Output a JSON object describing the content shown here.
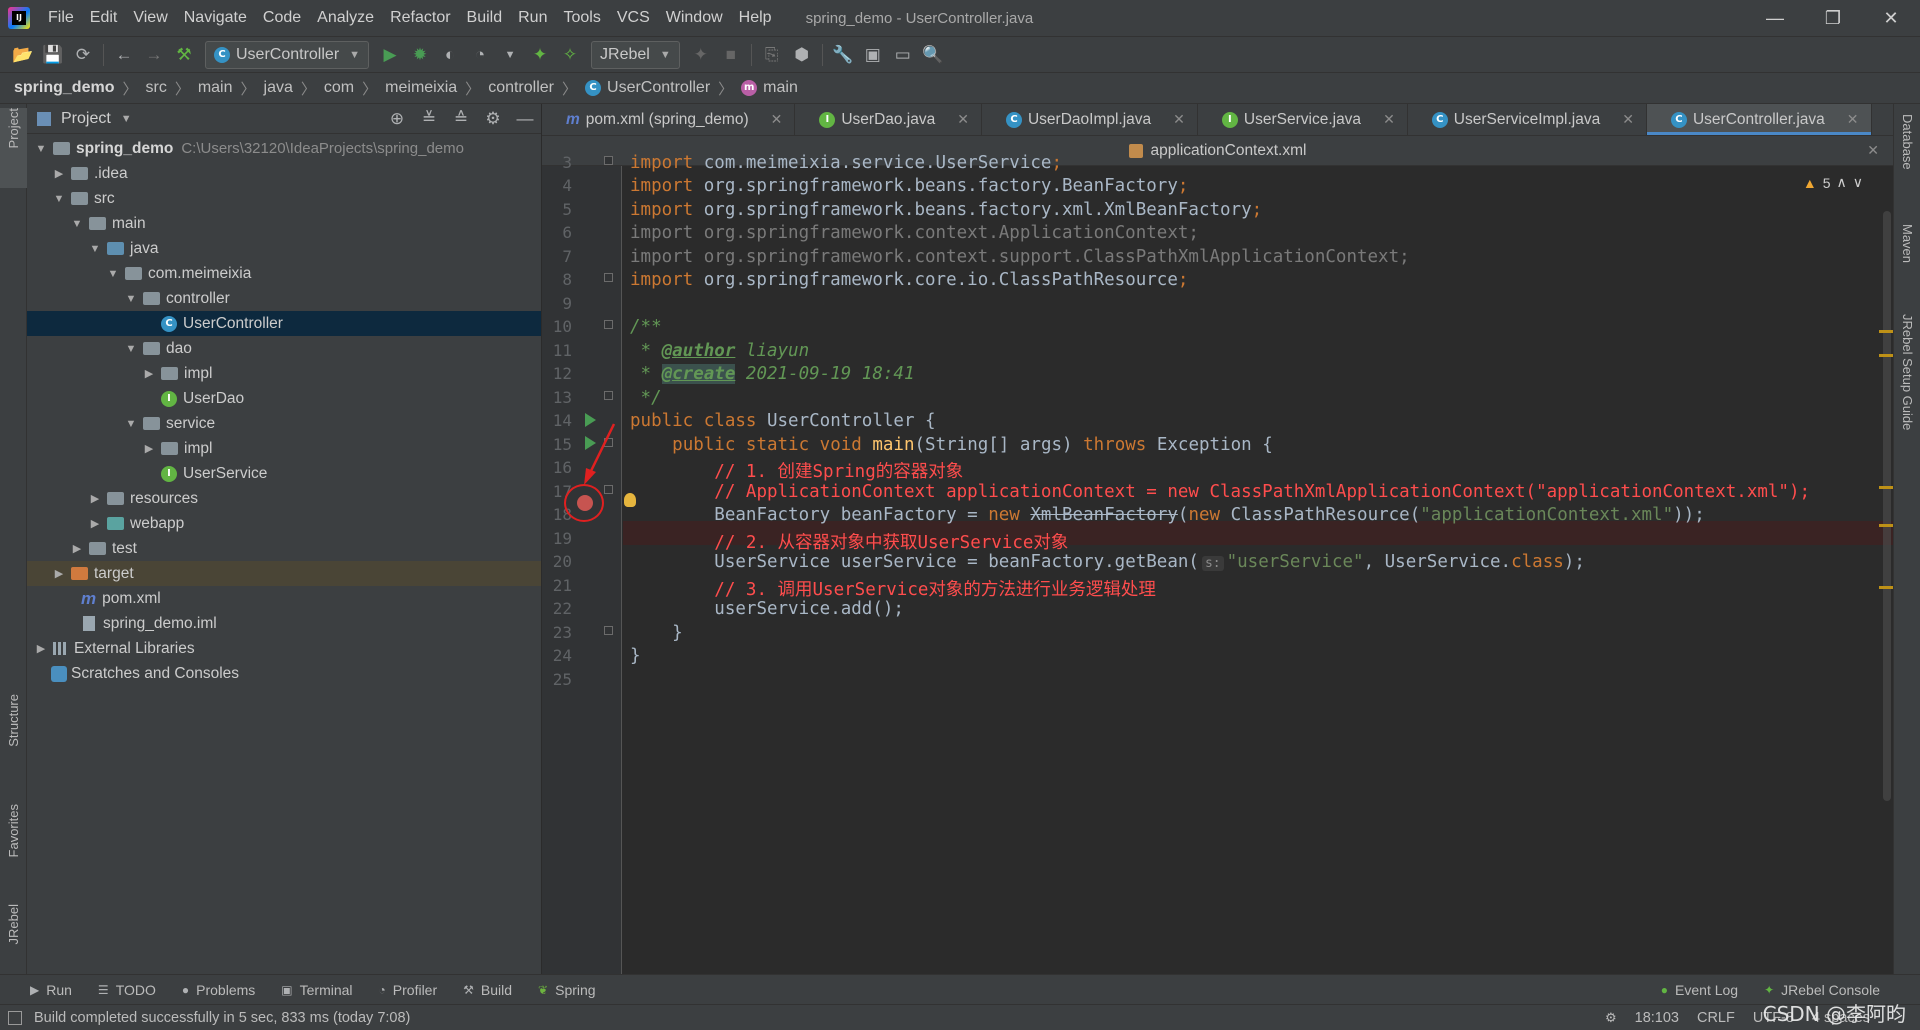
{
  "menubar": {
    "logo_text": "IJ",
    "items": [
      "File",
      "Edit",
      "View",
      "Navigate",
      "Code",
      "Analyze",
      "Refactor",
      "Build",
      "Run",
      "Tools",
      "VCS",
      "Window",
      "Help"
    ],
    "title": "spring_demo - UserController.java"
  },
  "toolbar": {
    "run_config": "UserController",
    "jrebel": "JRebel"
  },
  "breadcrumb": {
    "items": [
      "spring_demo",
      "src",
      "main",
      "java",
      "com",
      "meimeixia",
      "controller"
    ],
    "class_name": "UserController",
    "method": "main"
  },
  "left_strip": [
    "Project",
    "Structure",
    "Favorites",
    "JRebel"
  ],
  "right_strip": [
    "Database",
    "Maven",
    "JRebel Setup Guide"
  ],
  "project_panel": {
    "title": "Project",
    "tree": [
      {
        "label": "spring_demo",
        "path": "C:\\Users\\32120\\IdeaProjects\\spring_demo"
      },
      {
        "label": ".idea"
      },
      {
        "label": "src"
      },
      {
        "label": "main"
      },
      {
        "label": "java"
      },
      {
        "label": "com.meimeixia"
      },
      {
        "label": "controller"
      },
      {
        "label": "UserController"
      },
      {
        "label": "dao"
      },
      {
        "label": "impl"
      },
      {
        "label": "UserDao"
      },
      {
        "label": "service"
      },
      {
        "label": "impl"
      },
      {
        "label": "UserService"
      },
      {
        "label": "resources"
      },
      {
        "label": "webapp"
      },
      {
        "label": "test"
      },
      {
        "label": "target"
      },
      {
        "label": "pom.xml"
      },
      {
        "label": "spring_demo.iml"
      },
      {
        "label": "External Libraries"
      },
      {
        "label": "Scratches and Consoles"
      }
    ]
  },
  "editor_tabs": {
    "row1": [
      "pom.xml (spring_demo)",
      "UserDao.java",
      "UserDaoImpl.java",
      "UserService.java",
      "UserServiceImpl.java",
      "UserController.java"
    ],
    "row2": "applicationContext.xml",
    "active": "UserController.java"
  },
  "editor": {
    "warning_count": "5",
    "line_numbers": [
      "3",
      "4",
      "5",
      "6",
      "7",
      "8",
      "9",
      "10",
      "11",
      "12",
      "13",
      "14",
      "15",
      "16",
      "17",
      "18",
      "19",
      "20",
      "21",
      "22",
      "23",
      "24",
      "25"
    ],
    "code": {
      "l3_kw": "import",
      "l3": " com.meimeixia.service.UserService",
      "l4_kw": "import",
      "l4": " org.springframework.beans.factory.BeanFactory",
      "l5_kw": "import",
      "l5": " org.springframework.beans.factory.xml.XmlBeanFactory",
      "l6": "import org.springframework.context.ApplicationContext;",
      "l7": "import org.springframework.context.support.ClassPathXmlApplicationContext;",
      "l8_kw": "import",
      "l8": " org.springframework.core.io.ClassPathResource",
      "l10": "/**",
      "l11_star": " * ",
      "l11_tag": "@author",
      "l11_val": " liayun",
      "l12_star": " * ",
      "l12_tag": "@create",
      "l12_val": " 2021-09-19 18:41",
      "l13": " */",
      "l14_kw": "public class",
      "l14": " UserController {",
      "l15_kw": "public static void",
      "l15_fn": "main",
      "l15_a": "(String[] args) ",
      "l15_kw2": "throws",
      "l15_b": " Exception {",
      "l16_prefix": "// 1. ",
      "l16_red": "创建Spring的容器对象",
      "l17": "// ApplicationContext applicationContext = new ClassPathXmlApplicationContext(\"applicationContext.xml\");",
      "l18_a": "BeanFactory beanFactory = ",
      "l18_kw": "new",
      "l18_strike": "XmlBeanFactory",
      "l18_b": "(",
      "l18_kw2": "new",
      "l18_c": " ClassPathResource(",
      "l18_str": "\"applicationContext.xml\"",
      "l18_d": "));",
      "l19_prefix": "// 2. ",
      "l19_red": "从容器对象中获取UserService对象",
      "l20_a": "UserService userService = beanFactory.getBean(",
      "l20_hint": "s:",
      "l20_str": "\"userService\"",
      "l20_b": ", UserService.",
      "l20_kw": "class",
      "l20_c": ");",
      "l21_prefix": "// 3. ",
      "l21_red": "调用UserService对象的方法进行业务逻辑处理",
      "l22": "userService.add();",
      "l23": "}",
      "l24": "}"
    }
  },
  "bottom_tabs": {
    "left": [
      "Run",
      "TODO",
      "Problems",
      "Terminal",
      "Profiler",
      "Build",
      "Spring"
    ],
    "right": [
      "Event Log",
      "JRebel Console"
    ]
  },
  "status": {
    "message": "Build completed successfully in 5 sec, 833 ms (today 7:08)",
    "position": "18:103",
    "line_sep": "CRLF",
    "encoding": "UTF-8",
    "indent": "4 spaces"
  },
  "watermark": "CSDN @李阿昀",
  "colors": {
    "accent": "#4a88c7",
    "breakpoint": "#c75450",
    "annotation": "#e02020"
  }
}
